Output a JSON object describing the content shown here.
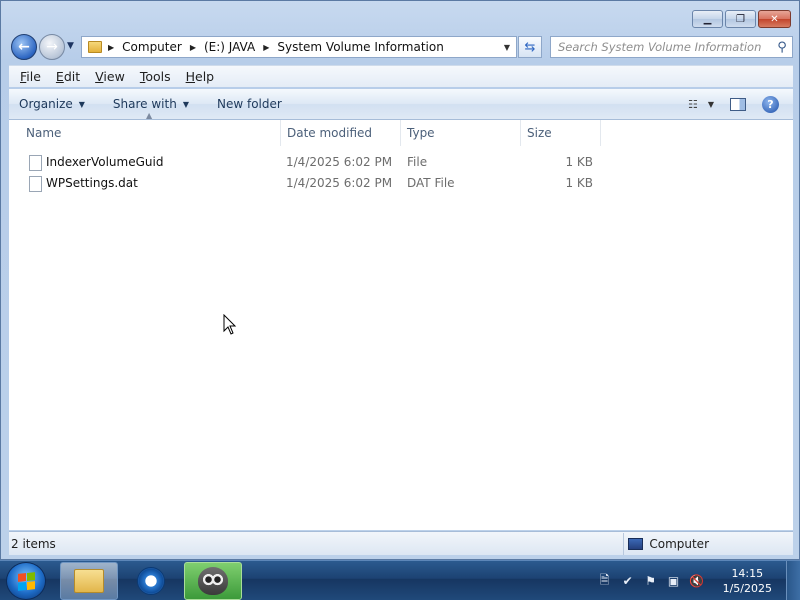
{
  "window": {
    "minimize_icon": "minimize-icon",
    "maximize_icon": "restore-icon",
    "close_icon": "close-icon"
  },
  "nav": {
    "back_icon": "back-arrow-icon",
    "forward_icon": "forward-arrow-icon",
    "breadcrumb": [
      "Computer",
      "(E:) JAVA",
      "System Volume Information"
    ],
    "search_placeholder": "Search System Volume Information"
  },
  "menubar": {
    "items": [
      {
        "label": "File",
        "accel": "F",
        "rest": "ile"
      },
      {
        "label": "Edit",
        "accel": "E",
        "rest": "dit"
      },
      {
        "label": "View",
        "accel": "V",
        "rest": "iew"
      },
      {
        "label": "Tools",
        "accel": "T",
        "rest": "ools"
      },
      {
        "label": "Help",
        "accel": "H",
        "rest": "elp"
      }
    ]
  },
  "toolbar": {
    "organize": "Organize",
    "share_with": "Share with",
    "new_folder": "New folder"
  },
  "columns": {
    "name": "Name",
    "date_modified": "Date modified",
    "type": "Type",
    "size": "Size"
  },
  "files": [
    {
      "name": "IndexerVolumeGuid",
      "date": "1/4/2025 6:02 PM",
      "type": "File",
      "size": "1 KB"
    },
    {
      "name": "WPSettings.dat",
      "date": "1/4/2025 6:02 PM",
      "type": "DAT File",
      "size": "1 KB"
    }
  ],
  "status": {
    "item_count": "2 items",
    "zone": "Computer"
  },
  "taskbar": {
    "time": "14:15",
    "date": "1/5/2025"
  },
  "colors": {
    "accent": "#2d66c2",
    "taskbar": "#1c4272"
  }
}
